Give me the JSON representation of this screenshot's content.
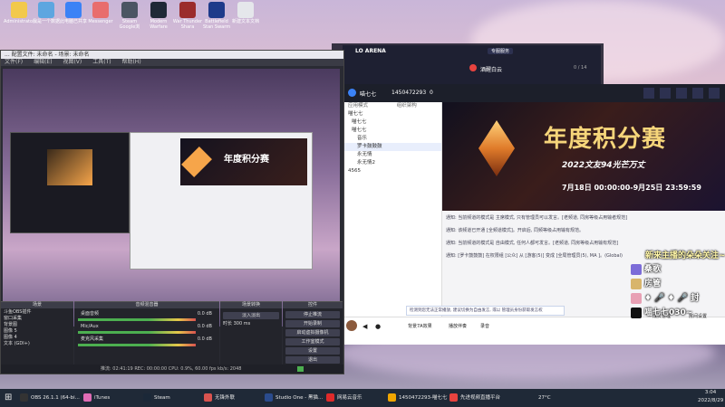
{
  "desktop_icons": [
    {
      "label": "Administrato...",
      "color": "#f2c94c"
    },
    {
      "label": "我是一个数据",
      "color": "#5da6e0"
    },
    {
      "label": "此电脑已共享",
      "color": "#3b82f6"
    },
    {
      "label": "Messenger",
      "color": "#e86d6d"
    },
    {
      "label": "Steam Google浏",
      "color": "#4b5563"
    },
    {
      "label": "Modern Warfare",
      "color": "#1f2937"
    },
    {
      "label": "War Thunder Shara",
      "color": "#9b2c2c"
    },
    {
      "label": "Battlefield Stan Swarm",
      "color": "#1e3a8a"
    },
    {
      "label": "新建文本文档",
      "color": "#e5e7eb"
    }
  ],
  "obs": {
    "title": "OBS 26.1.1 (64-bit, windows) - 配置文件: 未命名 - 场景: 未命名",
    "title_short": "... 配置文件: 未命名 - 场景: 未命名",
    "menu": [
      "文件(F)",
      "编辑(E)",
      "视图(V)",
      "工具(T)",
      "帮助(H)"
    ],
    "docks": {
      "scenes": "场景",
      "sources": "来源",
      "mixer": "音频混音器",
      "transitions": "场景转换",
      "controls": "控件"
    },
    "sources": [
      "斗鱼OBS插件",
      "窗口采集",
      "背景图",
      "图像 5",
      "图像 4",
      "文本 (GDI+)"
    ],
    "mixer": [
      {
        "name": "桌面音频",
        "db": "0.0 dB"
      },
      {
        "name": "Mic/Aux",
        "db": "0.0 dB"
      },
      {
        "name": "麦克风采集",
        "db": "0.0 dB"
      }
    ],
    "transition": {
      "type": "淡入淡出",
      "duration_label": "时长",
      "duration": "300 ms"
    },
    "controls": [
      "停止推流",
      "开始录制",
      "启动虚拟摄像机",
      "工作室模式",
      "设置",
      "退出"
    ],
    "status": "推流: 02:41:19   REC: 00:00:00   CPU: 0.9%, 60.00 fps   kb/s: 2048"
  },
  "launcher": {
    "title": "LO ARENA",
    "button": "专服服务",
    "user": "酒醒白云",
    "count": "0 / 14"
  },
  "chat": {
    "room_name": "喵七七",
    "room_id": "1450472293",
    "online": "0",
    "tabs": [
      "应用模式",
      "组织架构"
    ],
    "channels": [
      {
        "name": "喵七七",
        "indent": 0
      },
      {
        "name": "喵七七",
        "indent": 1
      },
      {
        "name": "喵七七",
        "indent": 1
      },
      {
        "name": "音乐",
        "indent": 2
      },
      {
        "name": "罗卡鼓鼓鼓",
        "indent": 2
      },
      {
        "name": "永无情",
        "indent": 2
      },
      {
        "name": "永无情2",
        "indent": 2
      },
      {
        "name": "4565",
        "indent": 0
      }
    ],
    "banner": {
      "title": "年度积分赛",
      "subtitle": "2022文友94光芒万丈",
      "date": "7月18日 00:00:00-9月25日 23:59:59"
    },
    "messages": [
      "通知: 当前频道的模式是 主席模式, 只有管理员可以发言。[老频道, 同房等级占用输者规范]",
      "通知: 该频道已开通 [全频道模式]。开启后, 同频等级占用输有规范。",
      "通知: 当前频道的模式是 自由模式, 任何人都可发言。[老频道, 同房等级占用输有规范]",
      "通知: [罗卡鼓鼓鼓] 在权限组 [公众] 从 [游客(5)] 变成 [全局管理员(5), MA ]。(Global)"
    ],
    "notice": "检测到您无法正常播放, 建议切换为自由发言, 或以 管理员身份获取发言权",
    "bottom": [
      "背景7A效果",
      "播放伴奏",
      "录音"
    ],
    "toolbar_right": [
      "成员管理",
      "房间设置"
    ]
  },
  "overlay": {
    "title": "新来主播的朵朵关注~",
    "users": [
      "桑歌",
      "房管",
      "♦ 🎤 ♦ 🎤 封",
      "喵七七030~"
    ]
  },
  "taskbar": {
    "items": [
      "OBS 26.1.1 (64-bi...",
      "iTunes",
      "Steam",
      "无锋外联",
      "Studio One - 黑猫...",
      "网易云音乐",
      "1450472293-喵七七",
      "先进视频直播平台"
    ],
    "weather": "27°C",
    "time": "3:04",
    "date": "2022/8/29"
  },
  "colors": {
    "accent": "#e8433f",
    "obs_bg": "#2a2b33",
    "taskbar": "#1f2937",
    "banner_gold": "#f6d57a"
  }
}
